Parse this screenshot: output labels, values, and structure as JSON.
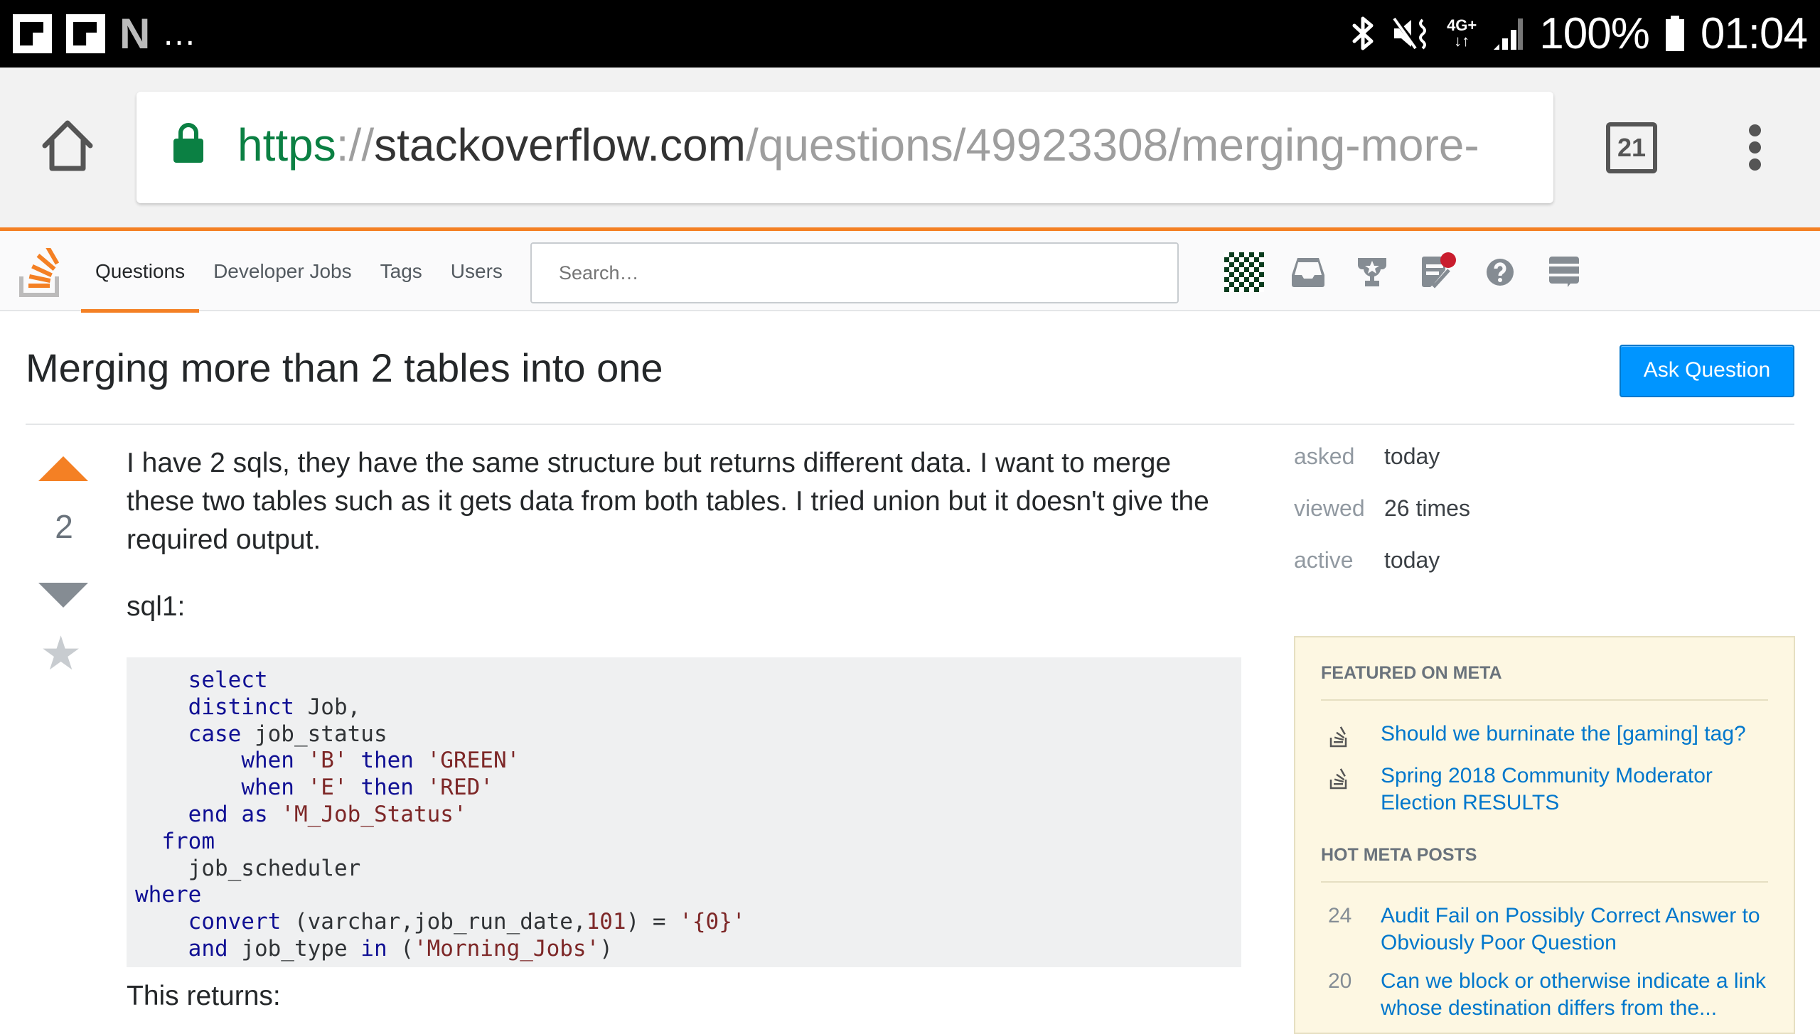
{
  "status_bar": {
    "notification_icons": [
      "flipboard-icon",
      "flipboard-icon",
      "netflix-icon"
    ],
    "more_indicator": "...",
    "network_label_top": "4G+",
    "battery_percent": "100%",
    "time": "01:04"
  },
  "browser": {
    "url_scheme": "https",
    "url_sep": "://",
    "url_host": "stackoverflow.com",
    "url_path": "/questions/49923308/merging-more-",
    "tab_count": "21"
  },
  "so_header": {
    "nav": [
      {
        "label": "Questions",
        "active": true
      },
      {
        "label": "Developer Jobs",
        "active": false
      },
      {
        "label": "Tags",
        "active": false
      },
      {
        "label": "Users",
        "active": false
      }
    ],
    "search_placeholder": "Search…",
    "colors": {
      "accent": "#f48024",
      "link": "#0077cc",
      "button": "#0095ff",
      "notification": "#c91d2e"
    }
  },
  "question": {
    "title": "Merging more than 2 tables into one",
    "ask_button": "Ask Question",
    "votes": "2",
    "body_intro": "I have 2 sqls, they have the same structure but returns different data. I want to merge these two tables such as it gets data from both tables. I tried union but it doesn't give the required output.",
    "sql_label": "sql1:",
    "code_lines": [
      "    select",
      "    distinct Job,",
      "    case job_status",
      "        when 'B' then 'GREEN'",
      "        when 'E' then 'RED'",
      "    end as 'M_Job_Status'",
      "  from",
      "    job_scheduler",
      "where",
      "    convert (varchar,job_run_date,101) = '{0}'",
      "    and job_type in ('Morning_Jobs')"
    ],
    "returns_label": "This returns:"
  },
  "stats": [
    {
      "label": "asked",
      "value": "today"
    },
    {
      "label": "viewed",
      "value": "26 times"
    },
    {
      "label": "active",
      "value": "today"
    }
  ],
  "meta": {
    "featured_heading": "FEATURED ON META",
    "featured": [
      {
        "title": "Should we burninate the [gaming] tag?"
      },
      {
        "title": "Spring 2018 Community Moderator Election RESULTS"
      }
    ],
    "hot_heading": "HOT META POSTS",
    "hot": [
      {
        "score": "24",
        "title": "Audit Fail on Possibly Correct Answer to Obviously Poor Question"
      },
      {
        "score": "20",
        "title": "Can we block or otherwise indicate a link whose destination differs from the..."
      }
    ]
  }
}
